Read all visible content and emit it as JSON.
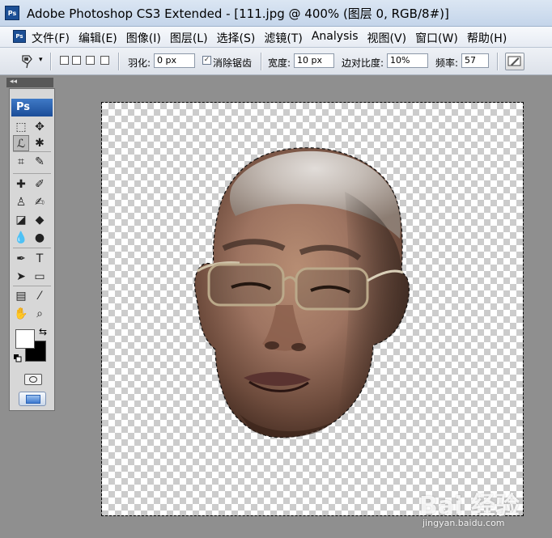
{
  "window": {
    "title": "Adobe Photoshop CS3 Extended - [111.jpg @ 400% (图层 0, RGB/8#)]",
    "app_icon_text": "Ps"
  },
  "menu": {
    "items": [
      "文件(F)",
      "编辑(E)",
      "图像(I)",
      "图层(L)",
      "选择(S)",
      "滤镜(T)",
      "Analysis",
      "视图(V)",
      "窗口(W)",
      "帮助(H)"
    ]
  },
  "options": {
    "feather_label": "羽化:",
    "feather_value": "0 px",
    "antialias_label": "消除锯齿",
    "antialias_checked": true,
    "width_label": "宽度:",
    "width_value": "10 px",
    "edge_contrast_label": "边对比度:",
    "edge_contrast_value": "10%",
    "frequency_label": "频率:",
    "frequency_value": "57"
  },
  "toolbox": {
    "logo": "Ps",
    "collapse_glyph": "◂◂",
    "tools": [
      {
        "name": "rect-marquee-tool-icon",
        "glyph": "⬚"
      },
      {
        "name": "move-tool-icon",
        "glyph": "✥"
      },
      {
        "name": "magnetic-lasso-tool-icon",
        "glyph": "ℒ",
        "active": true
      },
      {
        "name": "magic-wand-tool-icon",
        "glyph": "✱"
      },
      {
        "name": "crop-tool-icon",
        "glyph": "⌗"
      },
      {
        "name": "slice-tool-icon",
        "glyph": "✎"
      },
      {
        "name": "healing-brush-tool-icon",
        "glyph": "✚"
      },
      {
        "name": "brush-tool-icon",
        "glyph": "✐"
      },
      {
        "name": "clone-stamp-tool-icon",
        "glyph": "♙"
      },
      {
        "name": "history-brush-tool-icon",
        "glyph": "✍"
      },
      {
        "name": "eraser-tool-icon",
        "glyph": "◪"
      },
      {
        "name": "paint-bucket-tool-icon",
        "glyph": "◆"
      },
      {
        "name": "blur-tool-icon",
        "glyph": "💧"
      },
      {
        "name": "dodge-tool-icon",
        "glyph": "●"
      },
      {
        "name": "pen-tool-icon",
        "glyph": "✒"
      },
      {
        "name": "type-tool-icon",
        "glyph": "T"
      },
      {
        "name": "path-selection-tool-icon",
        "glyph": "➤"
      },
      {
        "name": "rectangle-shape-tool-icon",
        "glyph": "▭"
      },
      {
        "name": "notes-tool-icon",
        "glyph": "▤"
      },
      {
        "name": "eyedropper-tool-icon",
        "glyph": "⁄"
      },
      {
        "name": "hand-tool-icon",
        "glyph": "✋"
      },
      {
        "name": "zoom-tool-icon",
        "glyph": "⌕"
      }
    ],
    "swap_glyph": "⇆"
  },
  "watermark": {
    "text": "Bai 经验",
    "url": "jingyan.baidu.com"
  },
  "colors": {
    "foreground": "#ffffff",
    "background": "#000000",
    "ps_blue": "#1b4d98"
  }
}
